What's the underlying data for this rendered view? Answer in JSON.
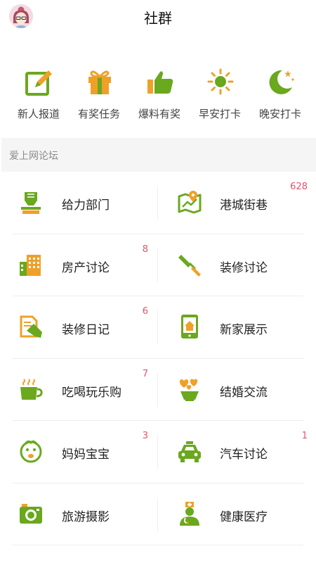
{
  "header": {
    "title": "社群"
  },
  "quick_actions": [
    {
      "label": "新人报道",
      "icon": "edit-icon"
    },
    {
      "label": "有奖任务",
      "icon": "gift-icon"
    },
    {
      "label": "爆料有奖",
      "icon": "thumbs-up-icon"
    },
    {
      "label": "早安打卡",
      "icon": "sun-icon"
    },
    {
      "label": "晚安打卡",
      "icon": "moon-icon"
    }
  ],
  "section": {
    "title": "爱上网论坛"
  },
  "forums": [
    {
      "label": "给力部门",
      "badge": "",
      "icon": "fist-badge-icon"
    },
    {
      "label": "港城街巷",
      "badge": "628",
      "icon": "map-pin-icon"
    },
    {
      "label": "房产讨论",
      "badge": "8",
      "icon": "building-icon"
    },
    {
      "label": "装修讨论",
      "badge": "",
      "icon": "paint-roller-icon"
    },
    {
      "label": "装修日记",
      "badge": "6",
      "icon": "document-pen-icon"
    },
    {
      "label": "新家展示",
      "badge": "",
      "icon": "phone-house-icon"
    },
    {
      "label": "吃喝玩乐购",
      "badge": "7",
      "icon": "coffee-cup-icon"
    },
    {
      "label": "结婚交流",
      "badge": "",
      "icon": "hearts-cup-icon"
    },
    {
      "label": "妈妈宝宝",
      "badge": "3",
      "icon": "baby-face-icon"
    },
    {
      "label": "汽车讨论",
      "badge": "1",
      "icon": "car-icon"
    },
    {
      "label": "旅游摄影",
      "badge": "",
      "icon": "camera-icon"
    },
    {
      "label": "健康医疗",
      "badge": "",
      "icon": "doctor-icon"
    }
  ],
  "colors": {
    "green": "#6aa81e",
    "orange": "#f0a028",
    "badge": "#e0556b"
  }
}
